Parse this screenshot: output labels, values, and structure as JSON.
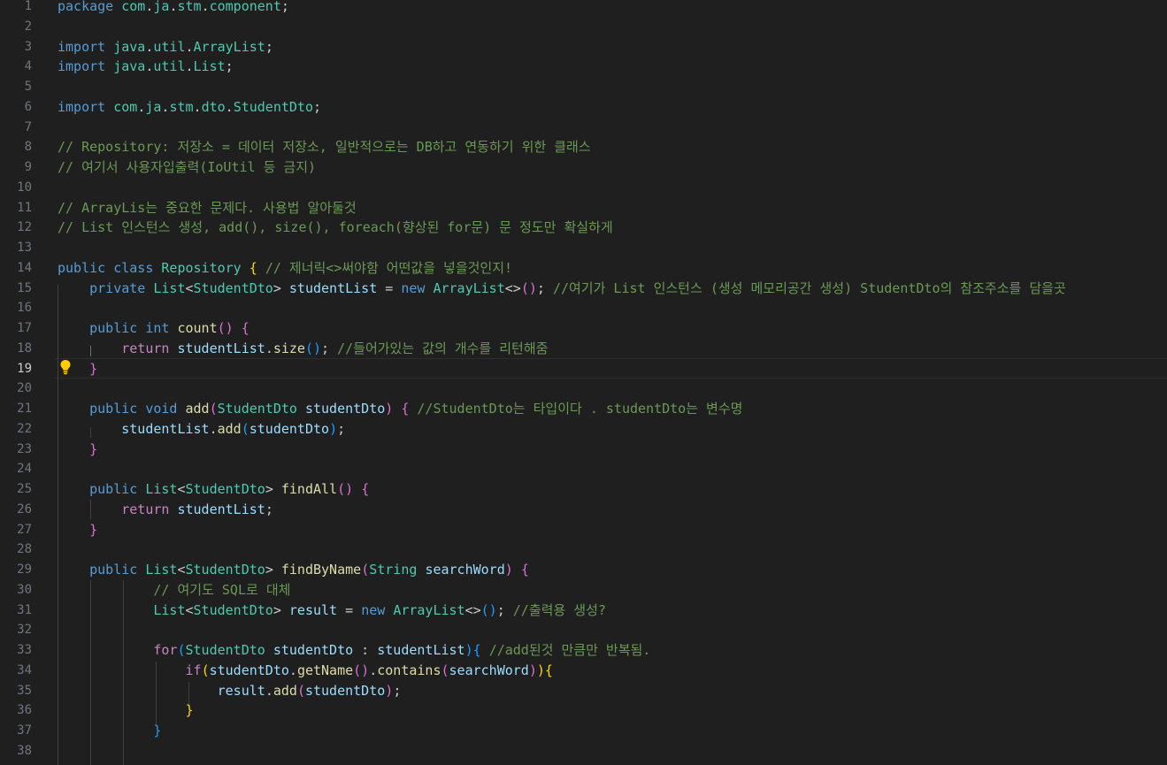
{
  "editor": {
    "active_line": 19,
    "lines": [
      {
        "n": "1",
        "t": [
          [
            "kw",
            "package"
          ],
          [
            "pn",
            " "
          ],
          [
            "ty",
            "com"
          ],
          [
            "pn",
            "."
          ],
          [
            "ty",
            "ja"
          ],
          [
            "pn",
            "."
          ],
          [
            "ty",
            "stm"
          ],
          [
            "pn",
            "."
          ],
          [
            "ty",
            "component"
          ],
          [
            "pn",
            ";"
          ]
        ]
      },
      {
        "n": "2",
        "t": []
      },
      {
        "n": "3",
        "t": [
          [
            "kw",
            "import"
          ],
          [
            "pn",
            " "
          ],
          [
            "ty",
            "java"
          ],
          [
            "pn",
            "."
          ],
          [
            "ty",
            "util"
          ],
          [
            "pn",
            "."
          ],
          [
            "ty",
            "ArrayList"
          ],
          [
            "pn",
            ";"
          ]
        ]
      },
      {
        "n": "4",
        "t": [
          [
            "kw",
            "import"
          ],
          [
            "pn",
            " "
          ],
          [
            "ty",
            "java"
          ],
          [
            "pn",
            "."
          ],
          [
            "ty",
            "util"
          ],
          [
            "pn",
            "."
          ],
          [
            "ty",
            "List"
          ],
          [
            "pn",
            ";"
          ]
        ]
      },
      {
        "n": "5",
        "t": []
      },
      {
        "n": "6",
        "t": [
          [
            "kw",
            "import"
          ],
          [
            "pn",
            " "
          ],
          [
            "ty",
            "com"
          ],
          [
            "pn",
            "."
          ],
          [
            "ty",
            "ja"
          ],
          [
            "pn",
            "."
          ],
          [
            "ty",
            "stm"
          ],
          [
            "pn",
            "."
          ],
          [
            "ty",
            "dto"
          ],
          [
            "pn",
            "."
          ],
          [
            "ty",
            "StudentDto"
          ],
          [
            "pn",
            ";"
          ]
        ]
      },
      {
        "n": "7",
        "t": []
      },
      {
        "n": "8",
        "t": [
          [
            "cm",
            "// Repository: 저장소 = 데이터 저장소, 일반적으로는 DB하고 연동하기 위한 클래스"
          ]
        ]
      },
      {
        "n": "9",
        "t": [
          [
            "cm",
            "// 여기서 사용자입출력(IoUtil 등 금지)"
          ]
        ]
      },
      {
        "n": "10",
        "t": []
      },
      {
        "n": "11",
        "t": [
          [
            "cm",
            "// ArrayLis는 중요한 문제다. 사용법 알아둘것"
          ]
        ]
      },
      {
        "n": "12",
        "t": [
          [
            "cm",
            "// List 인스턴스 생성, add(), size(), foreach(향상된 for문) 문 정도만 확실하게"
          ]
        ]
      },
      {
        "n": "13",
        "t": []
      },
      {
        "n": "14",
        "t": [
          [
            "kw",
            "public"
          ],
          [
            "pn",
            " "
          ],
          [
            "kw",
            "class"
          ],
          [
            "pn",
            " "
          ],
          [
            "ty",
            "Repository"
          ],
          [
            "pn",
            " "
          ],
          [
            "b1",
            "{"
          ],
          [
            "pn",
            " "
          ],
          [
            "cm",
            "// 제너릭<>써야함 어떤값을 넣을것인지!"
          ]
        ]
      },
      {
        "n": "15",
        "t": [
          [
            "pn",
            "    "
          ],
          [
            "kw",
            "private"
          ],
          [
            "pn",
            " "
          ],
          [
            "ty",
            "List"
          ],
          [
            "pn",
            "<"
          ],
          [
            "ty",
            "StudentDto"
          ],
          [
            "pn",
            "> "
          ],
          [
            "var",
            "studentList"
          ],
          [
            "pn",
            " = "
          ],
          [
            "kw",
            "new"
          ],
          [
            "pn",
            " "
          ],
          [
            "ty",
            "ArrayList"
          ],
          [
            "pn",
            "<>"
          ],
          [
            "b2",
            "()"
          ],
          [
            "pn",
            "; "
          ],
          [
            "cm",
            "//여기가 List 인스턴스 (생성 메모리공간 생성) StudentDto의 참조주소를 담을곳"
          ]
        ]
      },
      {
        "n": "16",
        "t": []
      },
      {
        "n": "17",
        "t": [
          [
            "pn",
            "    "
          ],
          [
            "kw",
            "public"
          ],
          [
            "pn",
            " "
          ],
          [
            "kw",
            "int"
          ],
          [
            "pn",
            " "
          ],
          [
            "fn",
            "count"
          ],
          [
            "b2",
            "()"
          ],
          [
            "pn",
            " "
          ],
          [
            "b2",
            "{"
          ]
        ]
      },
      {
        "n": "18",
        "t": [
          [
            "pn",
            "        "
          ],
          [
            "ctl",
            "return"
          ],
          [
            "pn",
            " "
          ],
          [
            "var",
            "studentList"
          ],
          [
            "pn",
            "."
          ],
          [
            "fn",
            "size"
          ],
          [
            "b3",
            "()"
          ],
          [
            "pn",
            "; "
          ],
          [
            "cm",
            "//들어가있는 값의 개수를 리턴해줌"
          ]
        ]
      },
      {
        "n": "19",
        "t": [
          [
            "pn",
            "    "
          ],
          [
            "b2",
            "}"
          ]
        ]
      },
      {
        "n": "20",
        "t": []
      },
      {
        "n": "21",
        "t": [
          [
            "pn",
            "    "
          ],
          [
            "kw",
            "public"
          ],
          [
            "pn",
            " "
          ],
          [
            "kw",
            "void"
          ],
          [
            "pn",
            " "
          ],
          [
            "fn",
            "add"
          ],
          [
            "b2",
            "("
          ],
          [
            "ty",
            "StudentDto"
          ],
          [
            "pn",
            " "
          ],
          [
            "var",
            "studentDto"
          ],
          [
            "b2",
            ")"
          ],
          [
            "pn",
            " "
          ],
          [
            "b2",
            "{"
          ],
          [
            "pn",
            " "
          ],
          [
            "cm",
            "//StudentDto는 타입이다 . studentDto는 변수명"
          ]
        ]
      },
      {
        "n": "22",
        "t": [
          [
            "pn",
            "        "
          ],
          [
            "var",
            "studentList"
          ],
          [
            "pn",
            "."
          ],
          [
            "fn",
            "add"
          ],
          [
            "b3",
            "("
          ],
          [
            "var",
            "studentDto"
          ],
          [
            "b3",
            ")"
          ],
          [
            "pn",
            ";"
          ]
        ]
      },
      {
        "n": "23",
        "t": [
          [
            "pn",
            "    "
          ],
          [
            "b2",
            "}"
          ]
        ]
      },
      {
        "n": "24",
        "t": []
      },
      {
        "n": "25",
        "t": [
          [
            "pn",
            "    "
          ],
          [
            "kw",
            "public"
          ],
          [
            "pn",
            " "
          ],
          [
            "ty",
            "List"
          ],
          [
            "pn",
            "<"
          ],
          [
            "ty",
            "StudentDto"
          ],
          [
            "pn",
            "> "
          ],
          [
            "fn",
            "findAll"
          ],
          [
            "b2",
            "()"
          ],
          [
            "pn",
            " "
          ],
          [
            "b2",
            "{"
          ]
        ]
      },
      {
        "n": "26",
        "t": [
          [
            "pn",
            "        "
          ],
          [
            "ctl",
            "return"
          ],
          [
            "pn",
            " "
          ],
          [
            "var",
            "studentList"
          ],
          [
            "pn",
            ";"
          ]
        ]
      },
      {
        "n": "27",
        "t": [
          [
            "pn",
            "    "
          ],
          [
            "b2",
            "}"
          ]
        ]
      },
      {
        "n": "28",
        "t": []
      },
      {
        "n": "29",
        "t": [
          [
            "pn",
            "    "
          ],
          [
            "kw",
            "public"
          ],
          [
            "pn",
            " "
          ],
          [
            "ty",
            "List"
          ],
          [
            "pn",
            "<"
          ],
          [
            "ty",
            "StudentDto"
          ],
          [
            "pn",
            "> "
          ],
          [
            "fn",
            "findByName"
          ],
          [
            "b2",
            "("
          ],
          [
            "ty",
            "String"
          ],
          [
            "pn",
            " "
          ],
          [
            "var",
            "searchWord"
          ],
          [
            "b2",
            ")"
          ],
          [
            "pn",
            " "
          ],
          [
            "b2",
            "{"
          ]
        ]
      },
      {
        "n": "30",
        "t": [
          [
            "pn",
            "            "
          ],
          [
            "cm",
            "// 여기도 SQL로 대체"
          ]
        ]
      },
      {
        "n": "31",
        "t": [
          [
            "pn",
            "            "
          ],
          [
            "ty",
            "List"
          ],
          [
            "pn",
            "<"
          ],
          [
            "ty",
            "StudentDto"
          ],
          [
            "pn",
            "> "
          ],
          [
            "var",
            "result"
          ],
          [
            "pn",
            " = "
          ],
          [
            "kw",
            "new"
          ],
          [
            "pn",
            " "
          ],
          [
            "ty",
            "ArrayList"
          ],
          [
            "pn",
            "<>"
          ],
          [
            "b3",
            "()"
          ],
          [
            "pn",
            "; "
          ],
          [
            "cm",
            "//출력용 생성?"
          ]
        ]
      },
      {
        "n": "32",
        "t": []
      },
      {
        "n": "33",
        "t": [
          [
            "pn",
            "            "
          ],
          [
            "ctl",
            "for"
          ],
          [
            "b3",
            "("
          ],
          [
            "ty",
            "StudentDto"
          ],
          [
            "pn",
            " "
          ],
          [
            "var",
            "studentDto"
          ],
          [
            "pn",
            " : "
          ],
          [
            "var",
            "studentList"
          ],
          [
            "b3",
            "){"
          ],
          [
            "pn",
            " "
          ],
          [
            "cm",
            "//add된것 만큼만 반복됨."
          ]
        ]
      },
      {
        "n": "34",
        "t": [
          [
            "pn",
            "                "
          ],
          [
            "ctl",
            "if"
          ],
          [
            "b1",
            "("
          ],
          [
            "var",
            "studentDto"
          ],
          [
            "pn",
            "."
          ],
          [
            "fn",
            "getName"
          ],
          [
            "b2",
            "()"
          ],
          [
            "pn",
            "."
          ],
          [
            "fn",
            "contains"
          ],
          [
            "b2",
            "("
          ],
          [
            "var",
            "searchWord"
          ],
          [
            "b2",
            ")"
          ],
          [
            "b1",
            "){"
          ]
        ]
      },
      {
        "n": "35",
        "t": [
          [
            "pn",
            "                    "
          ],
          [
            "var",
            "result"
          ],
          [
            "pn",
            "."
          ],
          [
            "fn",
            "add"
          ],
          [
            "b2",
            "("
          ],
          [
            "var",
            "studentDto"
          ],
          [
            "b2",
            ")"
          ],
          [
            "pn",
            ";"
          ]
        ]
      },
      {
        "n": "36",
        "t": [
          [
            "pn",
            "                "
          ],
          [
            "b1",
            "}"
          ]
        ]
      },
      {
        "n": "37",
        "t": [
          [
            "pn",
            "            "
          ],
          [
            "b3",
            "}"
          ]
        ]
      },
      {
        "n": "38",
        "t": []
      }
    ]
  },
  "colors": {
    "background": "#1f1f1f",
    "keyword": "#569cd6",
    "control": "#c586c0",
    "type": "#4ec9b0",
    "function": "#dcdcaa",
    "variable": "#9cdcfe",
    "comment": "#6a9955",
    "bracket_1": "#ffd700",
    "bracket_2": "#da70d6",
    "bracket_3": "#179fff"
  },
  "icons": {
    "code_action": "lightbulb-icon"
  }
}
